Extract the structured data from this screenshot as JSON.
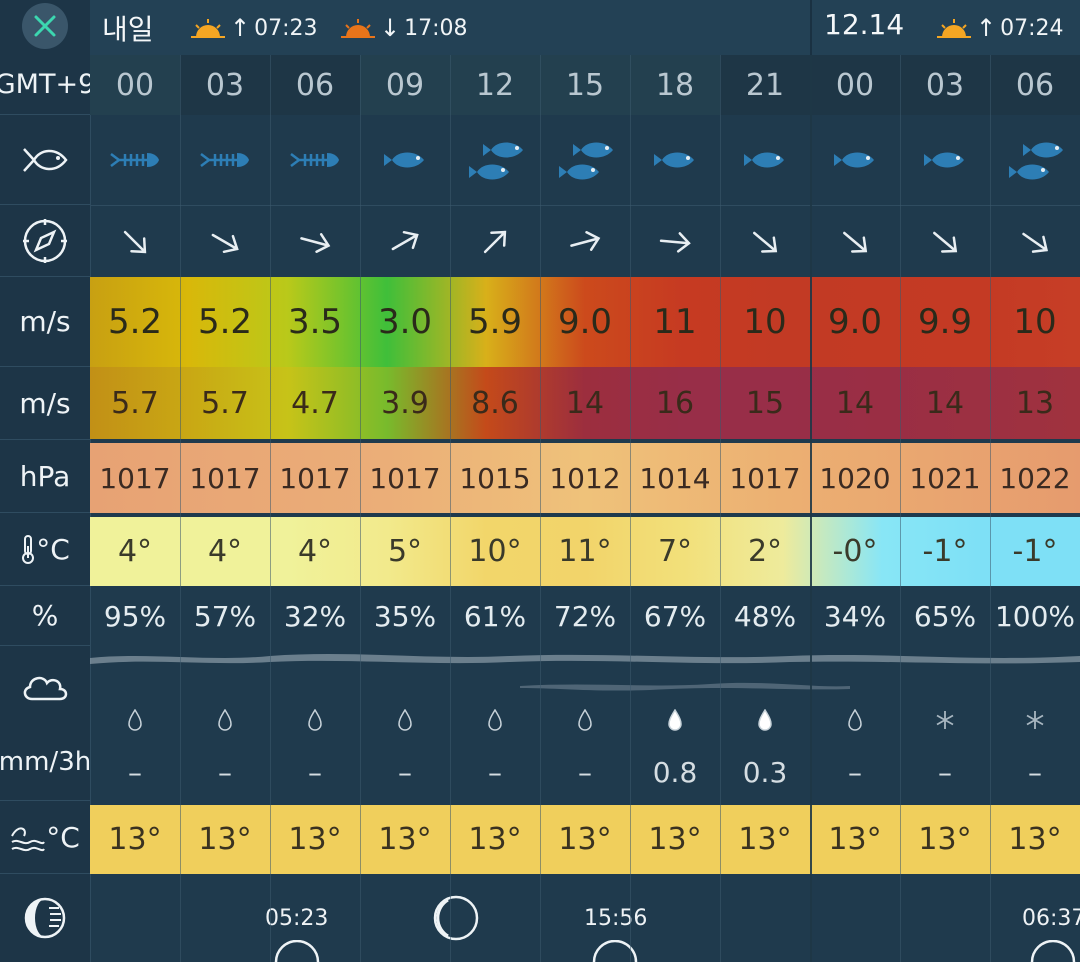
{
  "header": {
    "day_label": "내일",
    "sunrise_1": "07:23",
    "sunset_1": "17:08",
    "next_date": "12.14",
    "sunrise_2": "07:24"
  },
  "sidebar": {
    "timezone": "GMT+9",
    "wind_unit": "m/s",
    "gust_unit": "m/s",
    "pressure_unit": "hPa",
    "temp_unit": "°C",
    "humidity_unit": "%",
    "precip_unit": "mm/3h",
    "water_temp_unit": "°C"
  },
  "hours": [
    "00",
    "03",
    "06",
    "09",
    "12",
    "15",
    "18",
    "21",
    "00",
    "03",
    "06"
  ],
  "fish": [
    {
      "type": "bone"
    },
    {
      "type": "bone"
    },
    {
      "type": "bone"
    },
    {
      "type": "one"
    },
    {
      "type": "two"
    },
    {
      "type": "two"
    },
    {
      "type": "one"
    },
    {
      "type": "one"
    },
    {
      "type": "one"
    },
    {
      "type": "one"
    },
    {
      "type": "two"
    }
  ],
  "wind_dir_deg": [
    135,
    120,
    105,
    60,
    45,
    75,
    95,
    130,
    130,
    130,
    125
  ],
  "wind_speed": [
    "5.2",
    "5.2",
    "3.5",
    "3.0",
    "5.9",
    "9.0",
    "11",
    "10",
    "9.0",
    "9.9",
    "10"
  ],
  "wind_gust": [
    "5.7",
    "5.7",
    "4.7",
    "3.9",
    "8.6",
    "14",
    "16",
    "15",
    "14",
    "14",
    "13"
  ],
  "pressure": [
    "1017",
    "1017",
    "1017",
    "1017",
    "1015",
    "1012",
    "1014",
    "1017",
    "1020",
    "1021",
    "1022"
  ],
  "temperature": [
    "4°",
    "4°",
    "4°",
    "5°",
    "10°",
    "11°",
    "7°",
    "2°",
    "-0°",
    "-1°",
    "-1°"
  ],
  "humidity": [
    "95%",
    "57%",
    "32%",
    "35%",
    "61%",
    "72%",
    "67%",
    "48%",
    "34%",
    "65%",
    "100%"
  ],
  "precip_icon": [
    "drop",
    "drop",
    "drop",
    "drop",
    "drop",
    "drop",
    "drop-filled",
    "drop-filled",
    "drop",
    "snow",
    "snow"
  ],
  "precipitation": [
    "–",
    "–",
    "–",
    "–",
    "–",
    "–",
    "0.8",
    "0.3",
    "–",
    "–",
    "–"
  ],
  "water_temp": [
    "13°",
    "13°",
    "13°",
    "13°",
    "13°",
    "13°",
    "13°",
    "13°",
    "13°",
    "13°",
    "13°"
  ],
  "moon": {
    "time_1": "05:23",
    "time_2": "15:56",
    "time_3": "06:37"
  },
  "colors": {
    "wind_gradient": [
      "#c8a012",
      "#d8b80a",
      "#b9c91a",
      "#3fbf3a",
      "#d8b01a",
      "#cc4a1c",
      "#c63a22",
      "#c23a24",
      "#c33a24",
      "#c43a24",
      "#c63e26"
    ],
    "gust_gradient": [
      "#c29016",
      "#c9a814",
      "#c7c318",
      "#78bb2c",
      "#c44a1a",
      "#9c2e3e",
      "#982e48",
      "#982e48",
      "#9a2e44",
      "#9c3042",
      "#a0323e"
    ],
    "pressure": "#e8a070",
    "temp_gradient": [
      "#f0f29a",
      "#f0f29a",
      "#f0f29a",
      "#f2ea8c",
      "#f2d66a",
      "#f2d46a",
      "#f2e07a",
      "#eeeb9c",
      "#88e6f6",
      "#7ee0f6",
      "#7ee0f6"
    ],
    "water": "#f0cf5c"
  }
}
